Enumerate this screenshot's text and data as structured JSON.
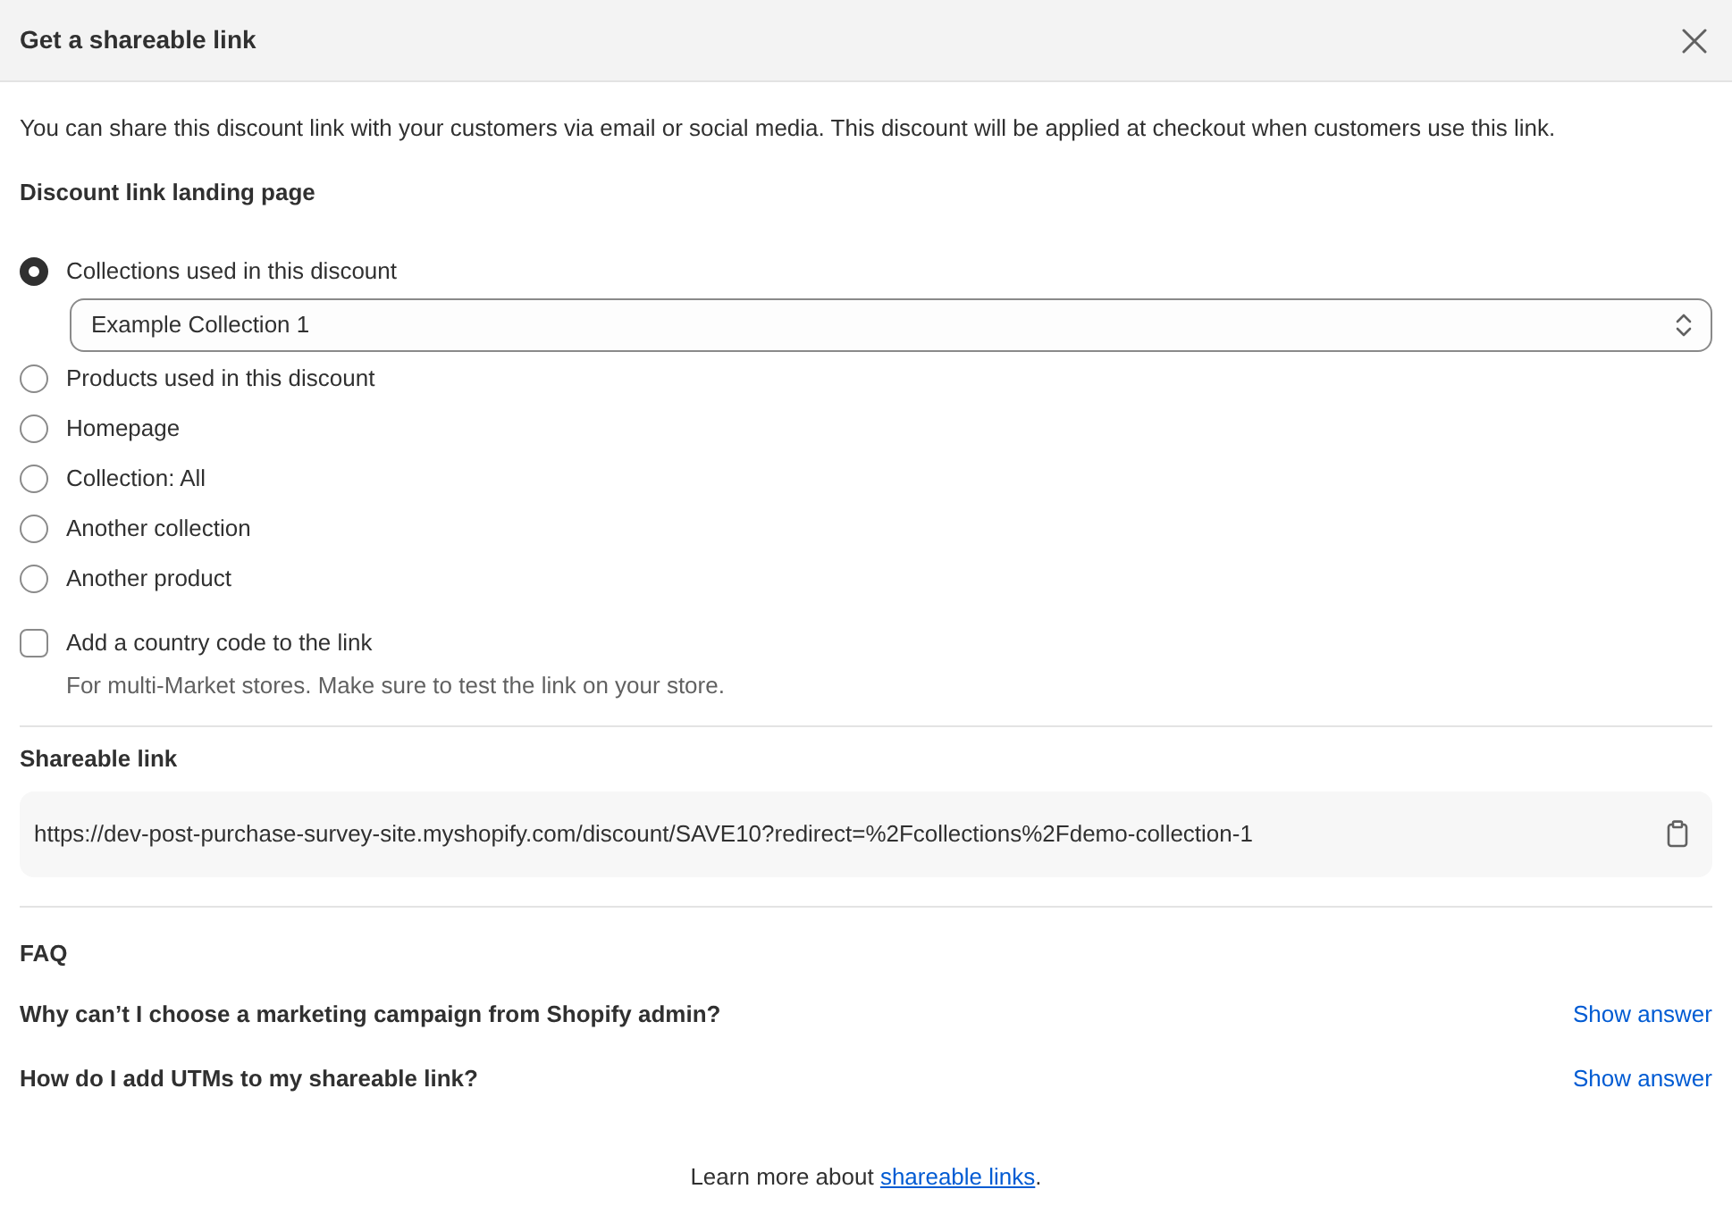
{
  "dialog": {
    "title": "Get a shareable link"
  },
  "intro": "You can share this discount link with your customers via email or social media. This discount will be applied at checkout when customers use this link.",
  "landing_page": {
    "heading": "Discount link landing page",
    "options": [
      {
        "label": "Collections used in this discount",
        "selected": true,
        "dropdown": {
          "value": "Example Collection 1"
        }
      },
      {
        "label": "Products used in this discount",
        "selected": false
      },
      {
        "label": "Homepage",
        "selected": false
      },
      {
        "label": "Collection: All",
        "selected": false
      },
      {
        "label": "Another collection",
        "selected": false
      },
      {
        "label": "Another product",
        "selected": false
      }
    ]
  },
  "country_code": {
    "label": "Add a country code to the link",
    "checked": false,
    "help": "For multi-Market stores. Make sure to test the link on your store."
  },
  "shareable_link": {
    "heading": "Shareable link",
    "url": "https://dev-post-purchase-survey-site.myshopify.com/discount/SAVE10?redirect=%2Fcollections%2Fdemo-collection-1"
  },
  "faq": {
    "heading": "FAQ",
    "items": [
      {
        "question": "Why can’t I choose a marketing campaign from Shopify admin?",
        "action": "Show answer"
      },
      {
        "question": "How do I add UTMs to my shareable link?",
        "action": "Show answer"
      }
    ]
  },
  "footer": {
    "text_before": "Learn more about ",
    "link": "shareable links",
    "text_after": "."
  }
}
